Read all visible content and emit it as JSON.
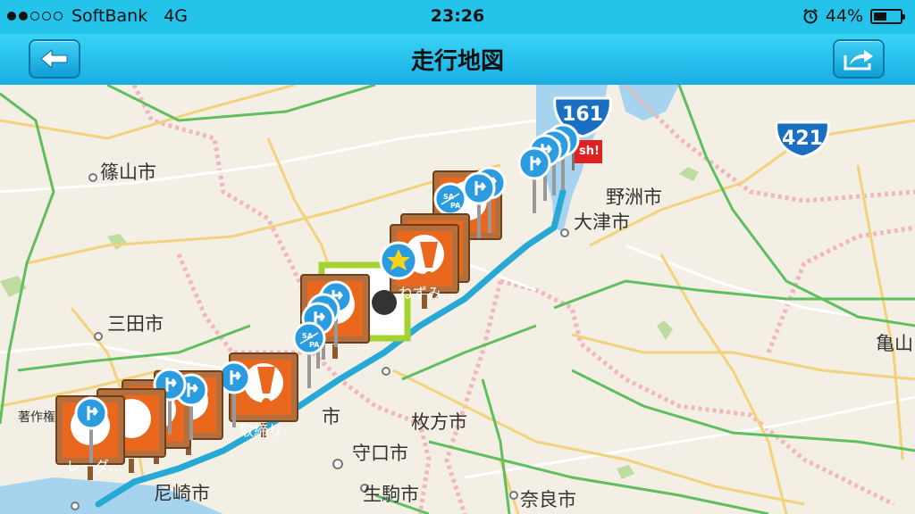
{
  "status_bar": {
    "carrier": "SoftBank",
    "network": "4G",
    "time": "23:26",
    "battery_percent": "44%",
    "battery_level": 0.44,
    "signal_bars_filled": 2,
    "signal_bars_total": 5
  },
  "nav": {
    "title": "走行地図",
    "back_icon": "back-arrow-icon",
    "share_icon": "share-icon"
  },
  "map": {
    "places": {
      "sasayama": "篠山市",
      "yasu": "野洲市",
      "otsu": "大津市",
      "sanda": "三田市",
      "kameyama": "亀山",
      "hirakata": "枚方市",
      "moriguchi": "守口市",
      "amagasaki": "尼崎市",
      "ikoma": "生駒市",
      "nara": "奈良市",
      "shi": "市",
      "copyright": "著作権情報"
    },
    "route_shields": {
      "r421": "421",
      "r161": "161"
    },
    "markers": {
      "radar": "レーダ…",
      "torishimari": "取締り",
      "nezumi": "ねずみ…",
      "dash": "…",
      "sapa": [
        "SA",
        "PA"
      ],
      "flag": "sh!"
    },
    "colors": {
      "route": "#27a9d6",
      "marker_orange": "#e9681d",
      "marker_frame": "#a5673c",
      "pin_blue": "#2b9ce0",
      "star_yellow": "#ffd21a",
      "green_frame": "#a3d231"
    }
  }
}
